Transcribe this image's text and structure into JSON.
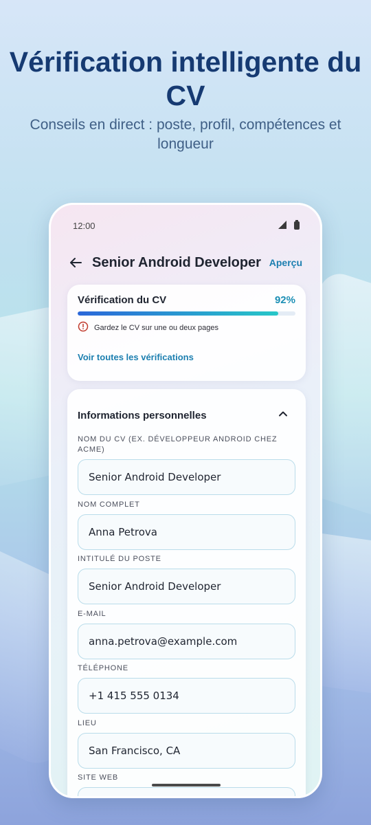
{
  "promo": {
    "headline": "Vérification intelligente du CV",
    "subheadline": "Conseils en direct : poste, profil, compétences et longueur"
  },
  "status_bar": {
    "time": "12:00",
    "icons": [
      "signal-icon",
      "battery-icon"
    ]
  },
  "app_bar": {
    "title": "Senior Android Developer",
    "preview_label": "Aperçu"
  },
  "cv_check": {
    "title": "Vérification du CV",
    "percent_label": "92%",
    "progress": 0.92,
    "warning": "Gardez le CV sur une ou deux pages",
    "see_all_label": "Voir toutes les vérifications"
  },
  "personal_info": {
    "section_title": "Informations personnelles",
    "fields": [
      {
        "label": "Nom du CV (ex. Développeur Android chez ACME)",
        "value": "Senior Android Developer"
      },
      {
        "label": "Nom complet",
        "value": "Anna Petrova"
      },
      {
        "label": "Intitulé du poste",
        "value": "Senior Android Developer"
      },
      {
        "label": "E-mail",
        "value": "anna.petrova@example.com"
      },
      {
        "label": "Téléphone",
        "value": "+1 415 555 0134"
      },
      {
        "label": "Lieu",
        "value": "San Francisco, CA"
      },
      {
        "label": "Site web",
        "value": ""
      }
    ]
  },
  "colors": {
    "headline": "#163a72",
    "accent": "#1c7fb0",
    "warning": "#c0392b"
  }
}
